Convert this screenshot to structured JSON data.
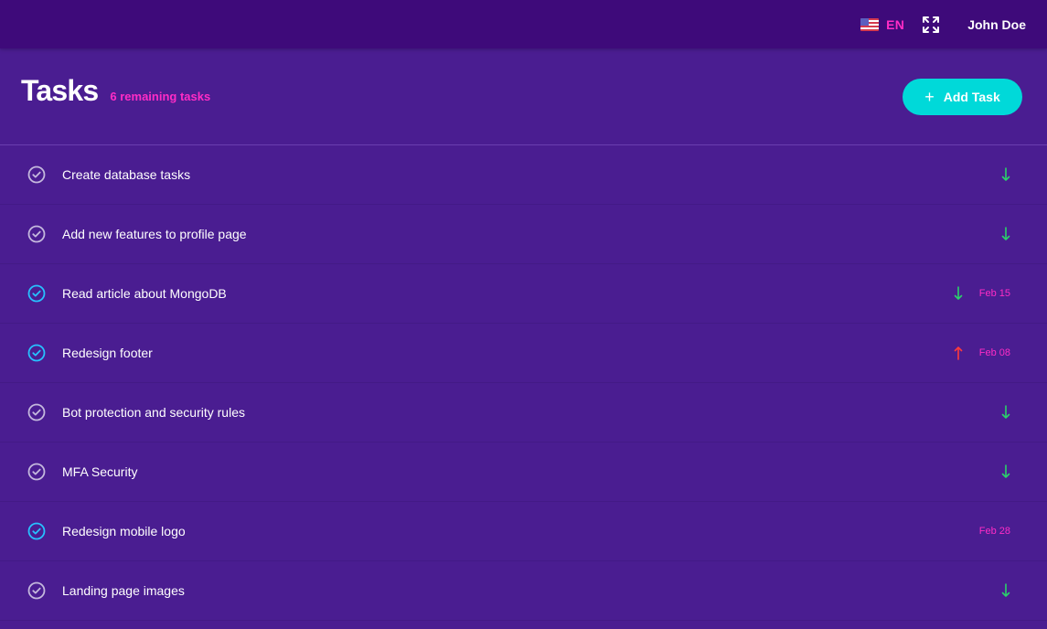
{
  "topbar": {
    "language_code": "EN",
    "user_name": "John Doe"
  },
  "header": {
    "title": "Tasks",
    "remaining_label": "6 remaining tasks",
    "add_button_label": "Add Task"
  },
  "colors": {
    "background": "#4a1d91",
    "topbar": "#3e0a7a",
    "accent_pink": "#ff2cc6",
    "accent_cyan": "#00d9d9",
    "check_done": "#27c1ff",
    "check_todo": "#c4b8dd",
    "arrow_down": "#2bd16b",
    "arrow_up": "#ff3b3b"
  },
  "tasks": [
    {
      "title": "Create database tasks",
      "done": false,
      "priority": "down",
      "due": ""
    },
    {
      "title": "Add new features to profile page",
      "done": false,
      "priority": "down",
      "due": ""
    },
    {
      "title": "Read article about MongoDB",
      "done": true,
      "priority": "down",
      "due": "Feb 15"
    },
    {
      "title": "Redesign footer",
      "done": true,
      "priority": "up",
      "due": "Feb 08"
    },
    {
      "title": "Bot protection and security rules",
      "done": false,
      "priority": "down",
      "due": ""
    },
    {
      "title": "MFA Security",
      "done": false,
      "priority": "down",
      "due": ""
    },
    {
      "title": "Redesign mobile logo",
      "done": true,
      "priority": "",
      "due": "Feb 28"
    },
    {
      "title": "Landing page images",
      "done": false,
      "priority": "down",
      "due": ""
    }
  ]
}
